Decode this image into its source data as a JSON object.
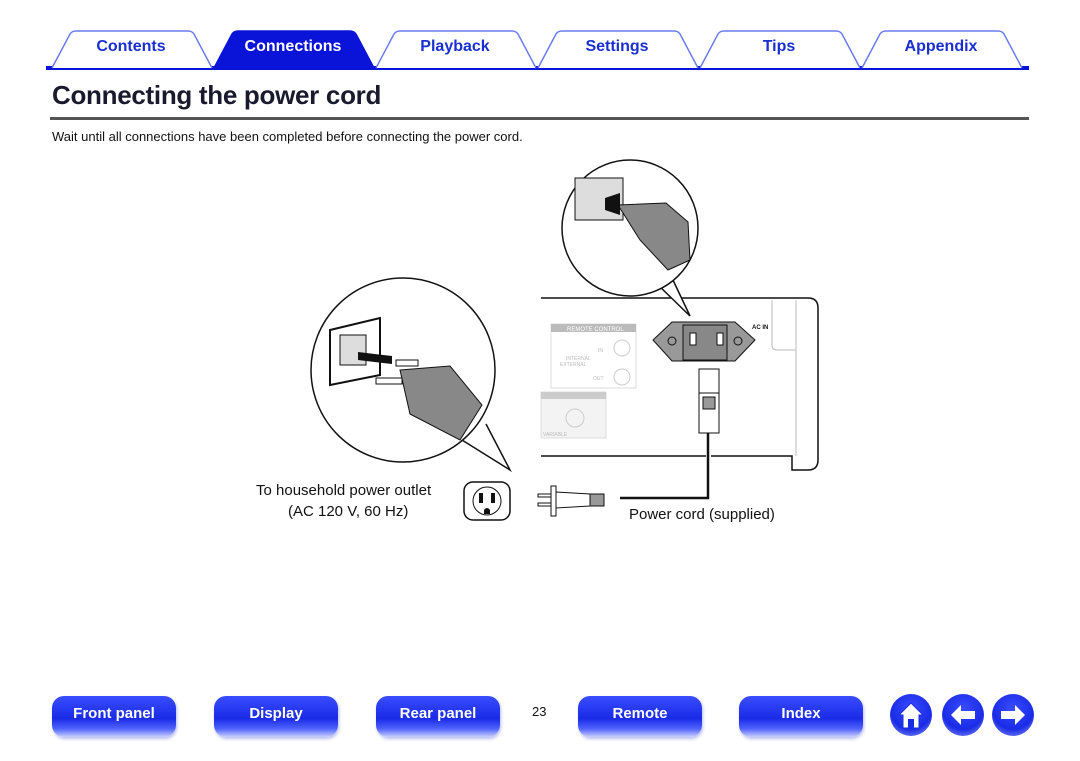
{
  "tabs": [
    {
      "label": "Contents",
      "active": false
    },
    {
      "label": "Connections",
      "active": true
    },
    {
      "label": "Playback",
      "active": false
    },
    {
      "label": "Settings",
      "active": false
    },
    {
      "label": "Tips",
      "active": false
    },
    {
      "label": "Appendix",
      "active": false
    }
  ],
  "page": {
    "title": "Connecting the power cord",
    "intro": "Wait until all connections have been completed before connecting the power cord.",
    "number": "23"
  },
  "diagram": {
    "outlet_label_line1": "To household power outlet",
    "outlet_label_line2": "(AC 120 V, 60 Hz)",
    "cord_label": "Power cord (supplied)",
    "panel_remote_control": "REMOTE CONTROL",
    "panel_ac_in": "AC IN",
    "panel_in": "IN",
    "panel_out": "OUT",
    "panel_internal": "INTERNAL",
    "panel_external": "EXTERNAL",
    "panel_variable": "VARIABLE"
  },
  "footer": {
    "buttons": [
      "Front panel",
      "Display",
      "Rear panel",
      "Remote",
      "Index"
    ],
    "icons": [
      "home-icon",
      "arrow-left-icon",
      "arrow-right-icon"
    ]
  },
  "colors": {
    "accent": "#0a14d8",
    "tab_outline": "#6a7cf0"
  }
}
